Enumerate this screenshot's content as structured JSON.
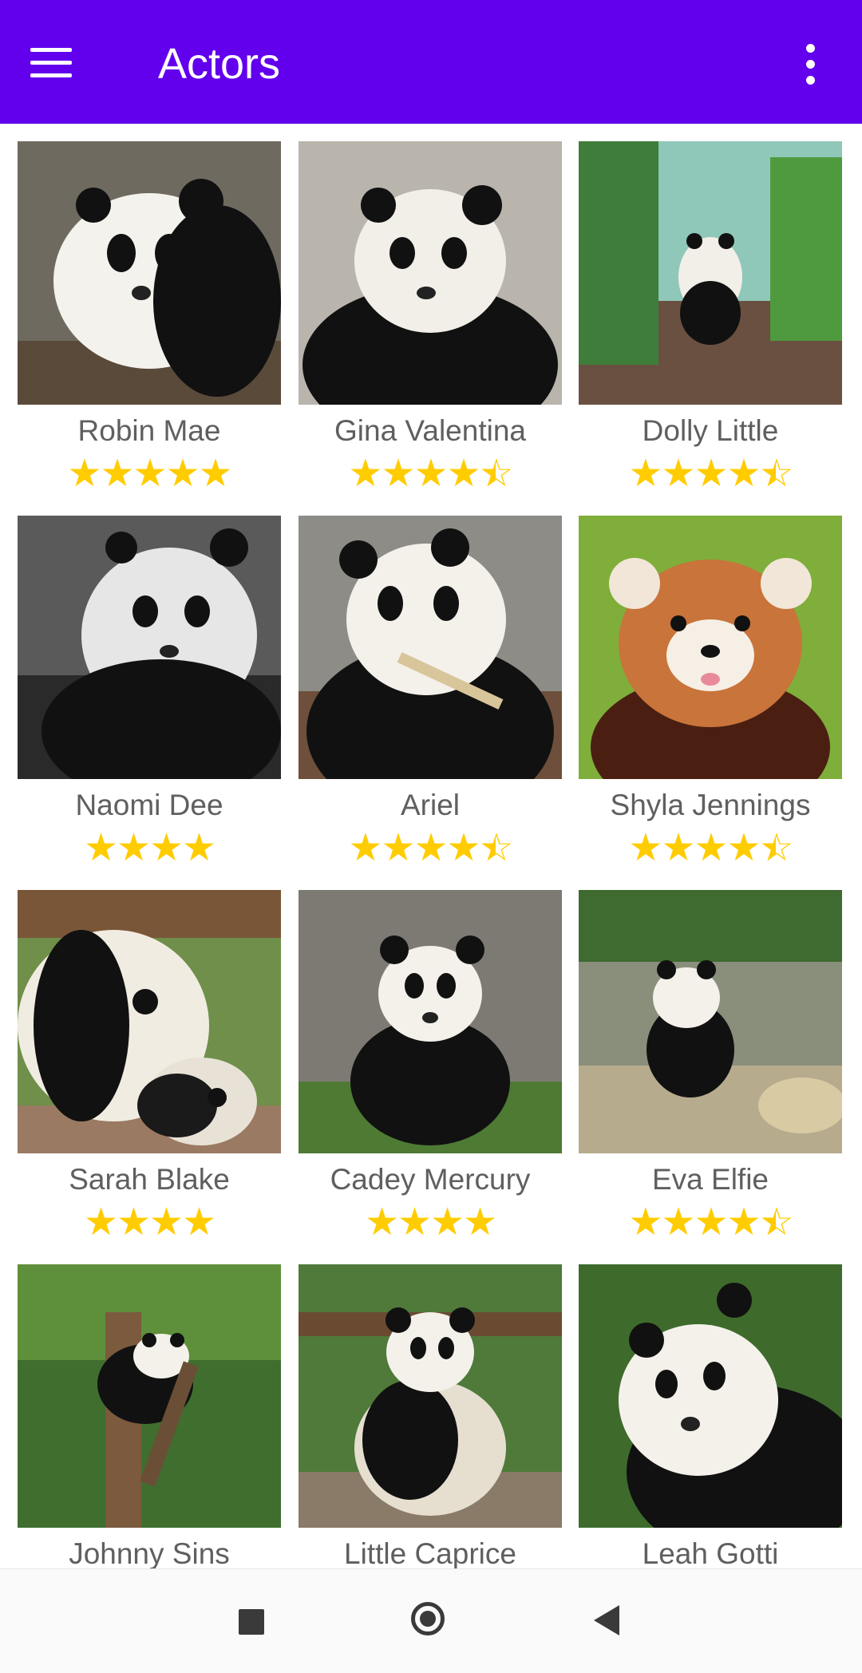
{
  "appbar": {
    "title": "Actors",
    "menu_icon": "hamburger-menu-icon",
    "overflow_icon": "more-vert-icon",
    "color": "#6200ee"
  },
  "actors": [
    {
      "name": "Robin Mae",
      "rating": 5,
      "stars": "★★★★★"
    },
    {
      "name": "Gina Valentina",
      "rating": 4.5,
      "stars": "★★★★"
    },
    {
      "name": "Dolly Little",
      "rating": 4.5,
      "stars": "★★★★"
    },
    {
      "name": "Naomi Dee",
      "rating": 4,
      "stars": "★★★★"
    },
    {
      "name": "Ariel",
      "rating": 4.5,
      "stars": "★★★★"
    },
    {
      "name": "Shyla Jennings",
      "rating": 4.5,
      "stars": "★★★★"
    },
    {
      "name": "Sarah Blake",
      "rating": 4,
      "stars": "★★★★"
    },
    {
      "name": "Cadey Mercury",
      "rating": 4,
      "stars": "★★★★"
    },
    {
      "name": "Eva Elfie",
      "rating": 4.5,
      "stars": "★★★★"
    },
    {
      "name": "Johnny Sins",
      "rating": null,
      "stars": ""
    },
    {
      "name": "Little Caprice",
      "rating": null,
      "stars": ""
    },
    {
      "name": "Leah Gotti",
      "rating": null,
      "stars": ""
    }
  ],
  "star_color": "#ffcc00",
  "navbar": {
    "recents_icon": "square-recents-icon",
    "home_icon": "circle-home-icon",
    "back_icon": "triangle-back-icon"
  }
}
